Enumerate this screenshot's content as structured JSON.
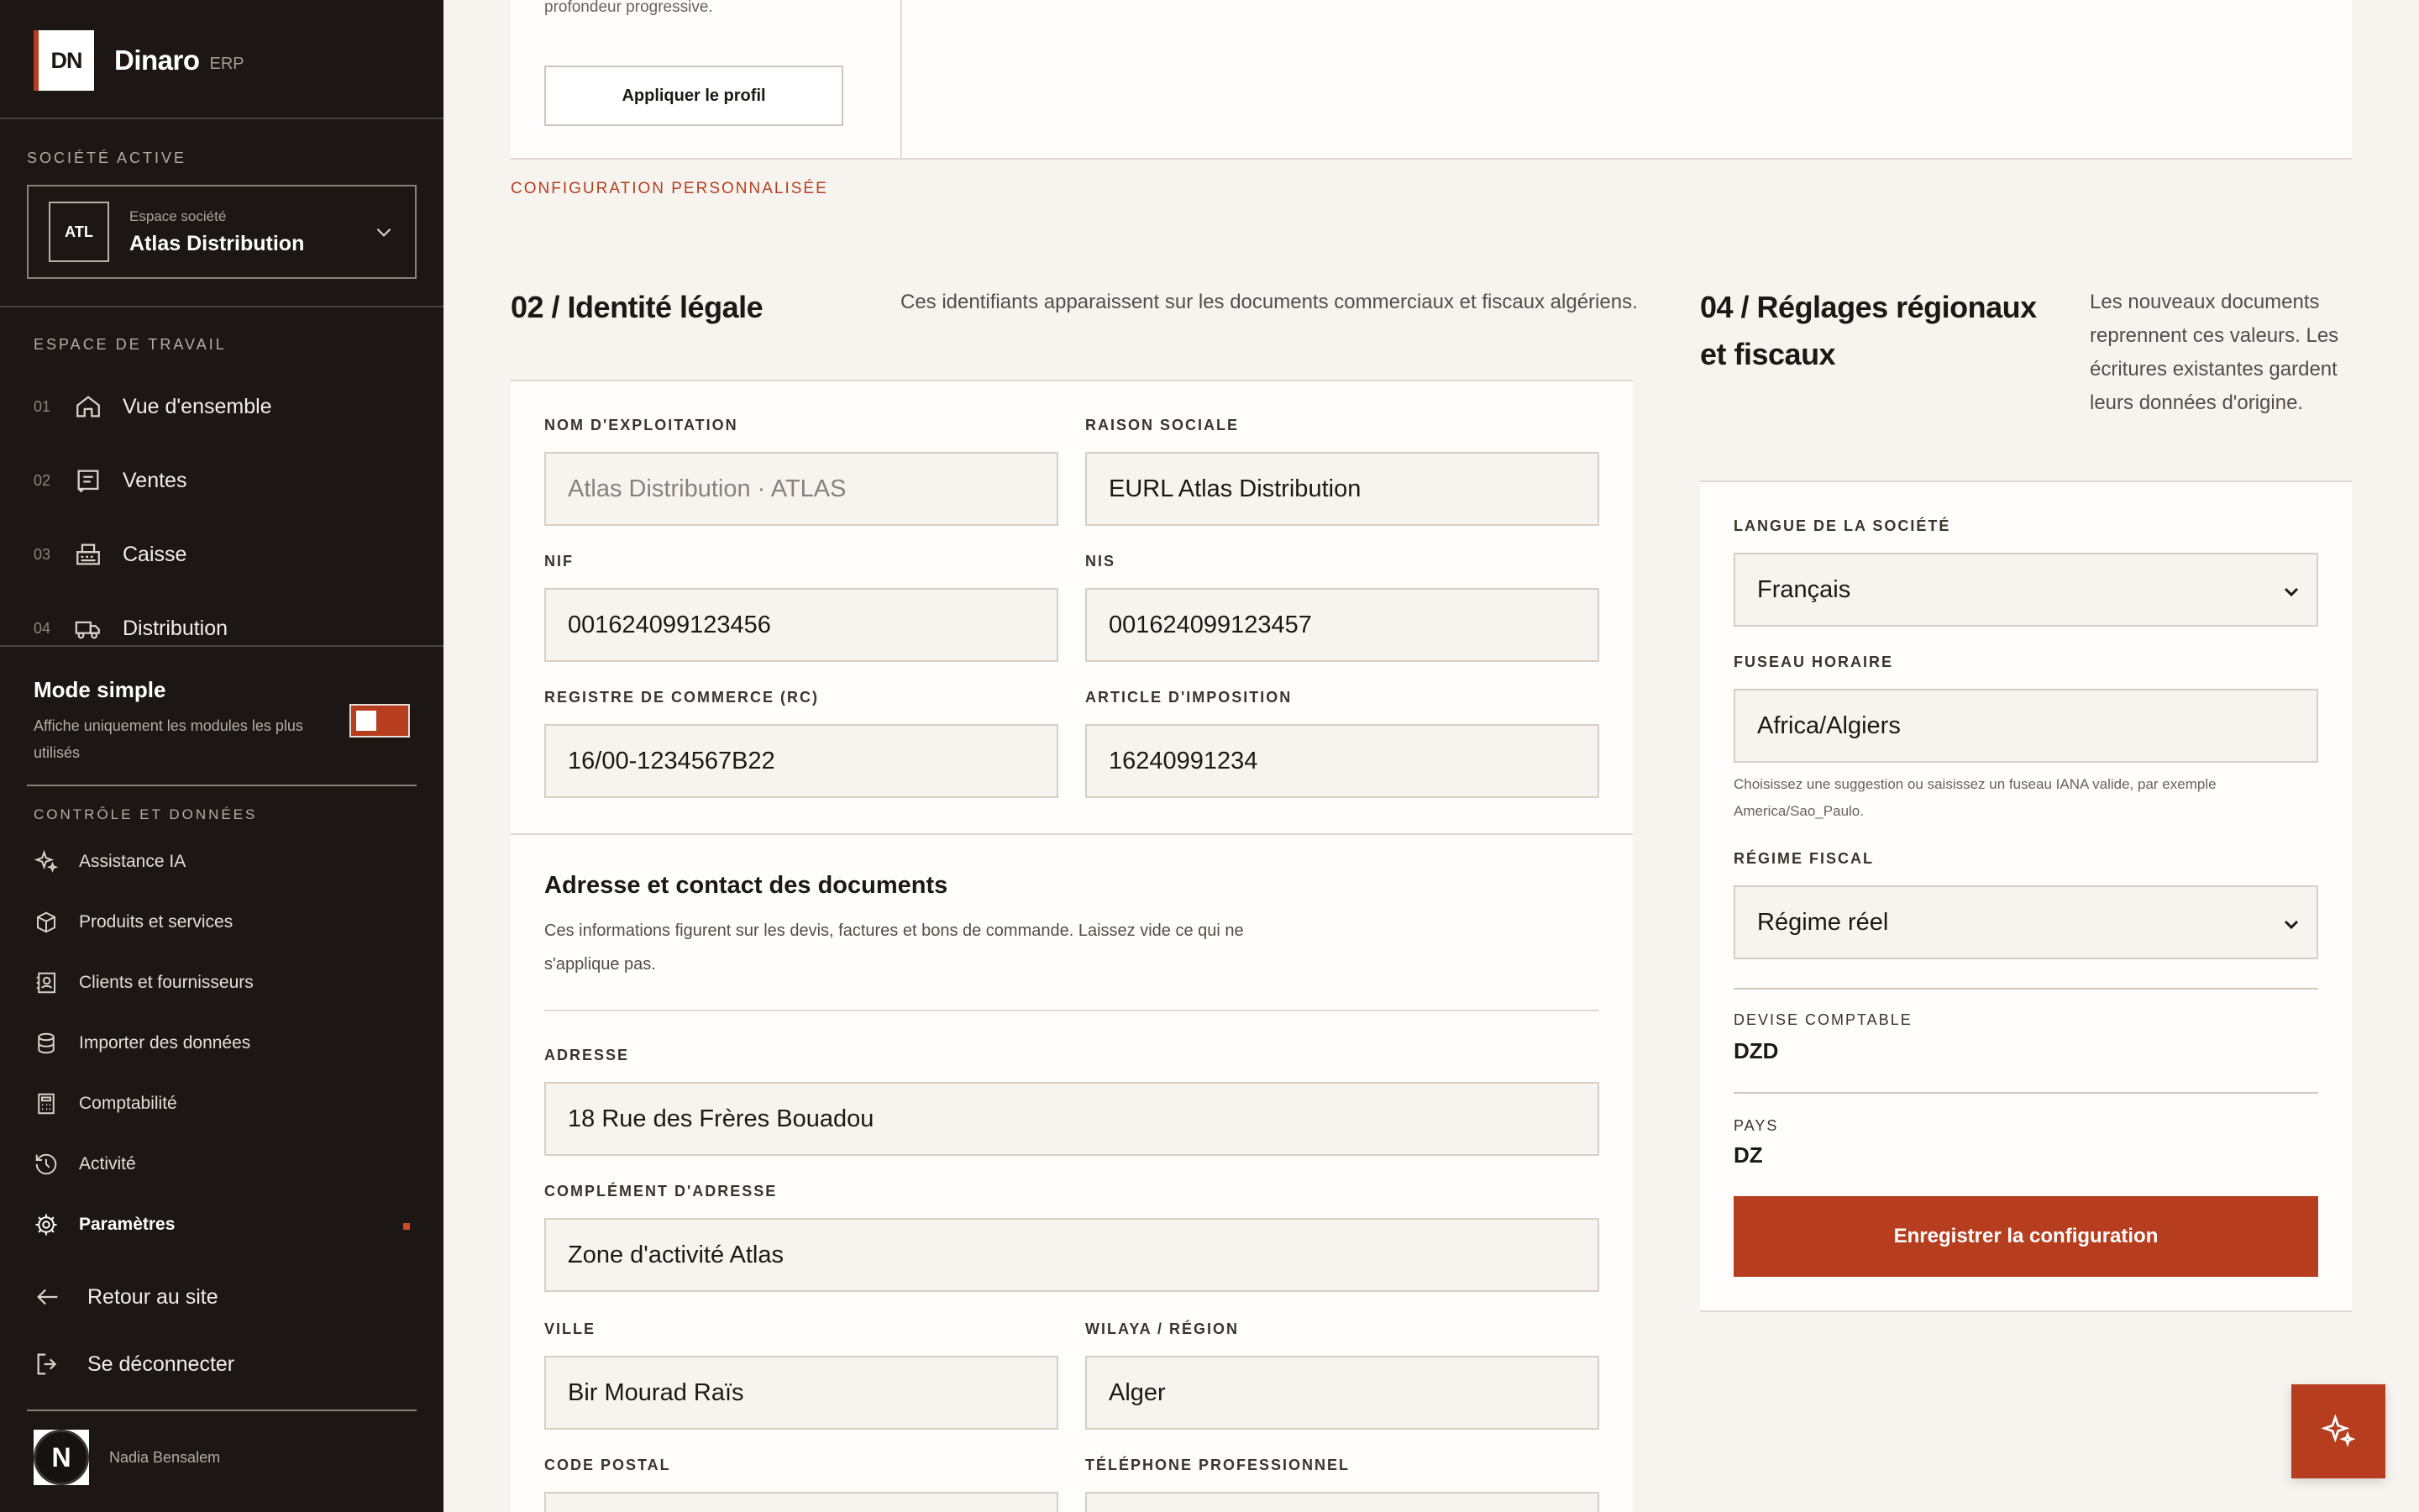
{
  "brand": {
    "logo": "DN",
    "name": "Dinaro",
    "tag": "ERP"
  },
  "sidebar": {
    "company_section": "SOCIÉTÉ ACTIVE",
    "company": {
      "badge": "ATL",
      "sub": "Espace société",
      "name": "Atlas Distribution"
    },
    "workspace_section": "ESPACE DE TRAVAIL",
    "nav": [
      {
        "num": "01",
        "label": "Vue d'ensemble",
        "icon": "home-icon"
      },
      {
        "num": "02",
        "label": "Ventes",
        "icon": "receipt-icon"
      },
      {
        "num": "03",
        "label": "Caisse",
        "icon": "register-icon"
      },
      {
        "num": "04",
        "label": "Distribution",
        "icon": "truck-icon"
      }
    ],
    "simple_mode": {
      "title": "Mode simple",
      "desc": "Affiche uniquement les modules les plus utilisés",
      "on": true
    },
    "control_section": "CONTRÔLE ET DONNÉES",
    "control_items": [
      {
        "label": "Assistance IA",
        "icon": "sparkles-icon"
      },
      {
        "label": "Produits et services",
        "icon": "box-icon"
      },
      {
        "label": "Clients et fournisseurs",
        "icon": "contacts-icon"
      },
      {
        "label": "Importer des données",
        "icon": "database-icon"
      },
      {
        "label": "Comptabilité",
        "icon": "calculator-icon"
      },
      {
        "label": "Activité",
        "icon": "history-icon"
      },
      {
        "label": "Paramètres",
        "icon": "gear-icon",
        "active": true
      }
    ],
    "back_label": "Retour au site",
    "logout_label": "Se déconnecter",
    "user": {
      "initial": "N",
      "name": "Nadia Bensalem"
    }
  },
  "top_card": {
    "hint": "profondeur progressive.",
    "apply_label": "Appliquer le profil"
  },
  "custom_label": "CONFIGURATION PERSONNALISÉE",
  "legal": {
    "title": "02 / Identité légale",
    "desc": "Ces identifiants apparaissent sur les documents commerciaux et fiscaux algériens.",
    "fields": {
      "trade_name": {
        "label": "NOM D'EXPLOITATION",
        "placeholder": "Atlas Distribution · ATLAS"
      },
      "company_name": {
        "label": "RAISON SOCIALE",
        "value": "EURL Atlas Distribution"
      },
      "nif": {
        "label": "NIF",
        "value": "001624099123456"
      },
      "nis": {
        "label": "NIS",
        "value": "001624099123457"
      },
      "rc": {
        "label": "REGISTRE DE COMMERCE (RC)",
        "value": "16/00-1234567B22"
      },
      "tax_article": {
        "label": "ARTICLE D'IMPOSITION",
        "value": "16240991234"
      }
    },
    "address_section": {
      "title": "Adresse et contact des documents",
      "desc": "Ces informations figurent sur les devis, factures et bons de commande. Laissez vide ce qui ne s'applique pas.",
      "address": {
        "label": "ADRESSE",
        "value": "18 Rue des Frères Bouadou"
      },
      "address2": {
        "label": "COMPLÉMENT D'ADRESSE",
        "value": "Zone d'activité Atlas"
      },
      "city": {
        "label": "VILLE",
        "value": "Bir Mourad Raïs"
      },
      "region": {
        "label": "WILAYA / RÉGION",
        "value": "Alger"
      },
      "postal_code": {
        "label": "CODE POSTAL",
        "value": ""
      },
      "phone": {
        "label": "TÉLÉPHONE PROFESSIONNEL",
        "value": ""
      }
    }
  },
  "regional": {
    "title": "04 / Réglages régionaux et fiscaux",
    "desc": "Les nouveaux documents reprennent ces valeurs. Les écritures existantes gardent leurs données d'origine.",
    "language": {
      "label": "LANGUE DE LA SOCIÉTÉ",
      "value": "Français"
    },
    "timezone": {
      "label": "FUSEAU HORAIRE",
      "value": "Africa/Algiers",
      "hint": "Choisissez une suggestion ou saisissez un fuseau IANA valide, par exemple America/Sao_Paulo."
    },
    "tax_regime": {
      "label": "RÉGIME FISCAL",
      "value": "Régime réel"
    },
    "currency": {
      "label": "DEVISE COMPTABLE",
      "value": "DZD"
    },
    "country": {
      "label": "PAYS",
      "value": "DZ"
    },
    "save_label": "Enregistrer la configuration"
  },
  "colors": {
    "accent": "#b63e1f",
    "sidebar_bg": "#1c1715",
    "page_bg": "#f7f4ef",
    "card_bg": "#fffdfb"
  }
}
